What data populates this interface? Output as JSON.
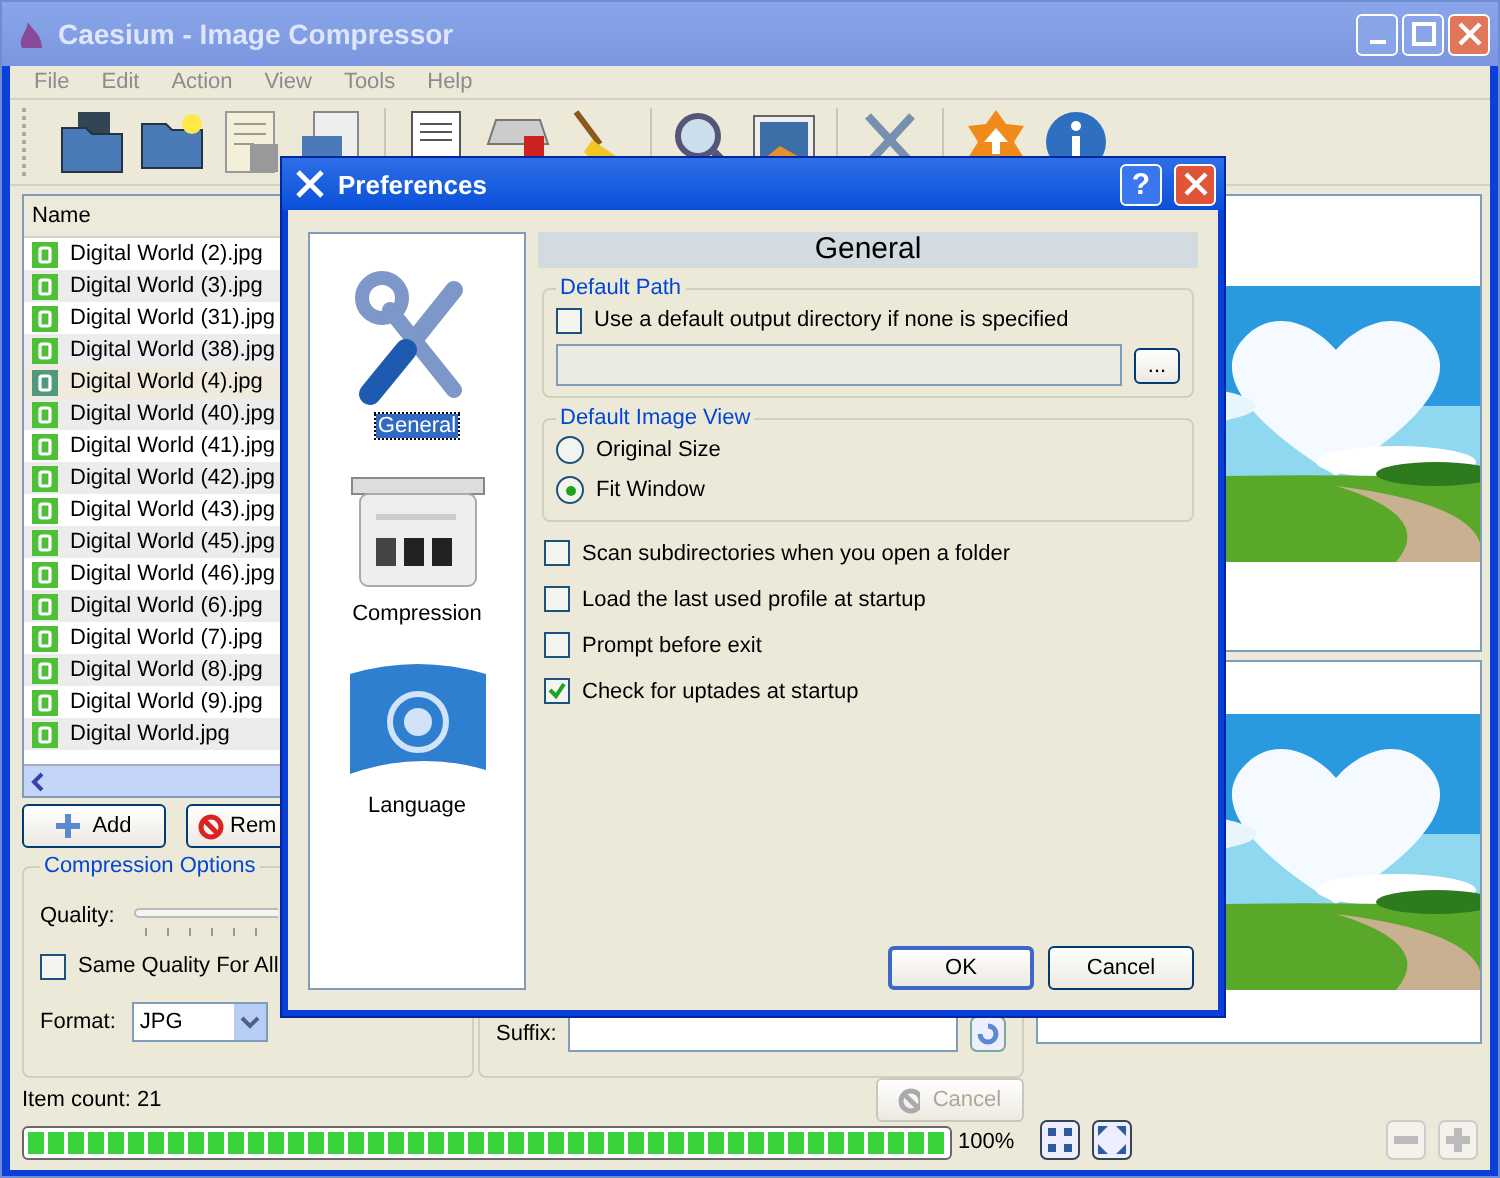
{
  "window": {
    "title": "Caesium - Image Compressor"
  },
  "menu": [
    "File",
    "Edit",
    "Action",
    "View",
    "Tools",
    "Help"
  ],
  "file_list": {
    "column": "Name",
    "rows": [
      {
        "name": "Digital World (2).jpg",
        "selected": false
      },
      {
        "name": "Digital World (3).jpg",
        "selected": false
      },
      {
        "name": "Digital World (31).jpg",
        "selected": false
      },
      {
        "name": "Digital World (38).jpg",
        "selected": false
      },
      {
        "name": "Digital World (4).jpg",
        "selected": true
      },
      {
        "name": "Digital World (40).jpg",
        "selected": false
      },
      {
        "name": "Digital World (41).jpg",
        "selected": false
      },
      {
        "name": "Digital World (42).jpg",
        "selected": false
      },
      {
        "name": "Digital World (43).jpg",
        "selected": false
      },
      {
        "name": "Digital World (45).jpg",
        "selected": false
      },
      {
        "name": "Digital World (46).jpg",
        "selected": false
      },
      {
        "name": "Digital World (6).jpg",
        "selected": false
      },
      {
        "name": "Digital World (7).jpg",
        "selected": false
      },
      {
        "name": "Digital World (8).jpg",
        "selected": false
      },
      {
        "name": "Digital World (9).jpg",
        "selected": false
      },
      {
        "name": "Digital World.jpg",
        "selected": false
      }
    ]
  },
  "list_buttons": {
    "add": "Add",
    "remove": "Rem"
  },
  "compression_options": {
    "title": "Compression Options",
    "quality_label": "Quality:",
    "same_quality": {
      "label": "Same Quality For All",
      "checked": false
    },
    "format_label": "Format:",
    "format": "JPG"
  },
  "suffix_label": "Suffix:",
  "status": {
    "item_count": "Item count: 21",
    "cancel": "Cancel",
    "progress": {
      "level": 1
    },
    "percent": "100%"
  },
  "dialog": {
    "title": "Preferences",
    "help": "?",
    "pages": [
      {
        "label": "General",
        "selected": true
      },
      {
        "label": "Compression",
        "selected": false
      },
      {
        "label": "Language",
        "selected": false
      }
    ],
    "header": "General",
    "default_path": {
      "title": "Default Path",
      "use_default": {
        "label": "Use a default output directory if none is specified",
        "checked": false
      },
      "browse": "..."
    },
    "image_view": {
      "title": "Default Image View",
      "options": [
        {
          "label": "Original Size",
          "selected": false
        },
        {
          "label": "Fit Window",
          "selected": true
        }
      ]
    },
    "options": [
      {
        "label": "Scan subdirectories when you open a folder",
        "checked": false
      },
      {
        "label": "Load the last used profile at startup",
        "checked": false
      },
      {
        "label": "Prompt before exit",
        "checked": false
      },
      {
        "label": "Check for uptades at startup",
        "checked": true
      }
    ],
    "ok": "OK",
    "cancel": "Cancel"
  }
}
